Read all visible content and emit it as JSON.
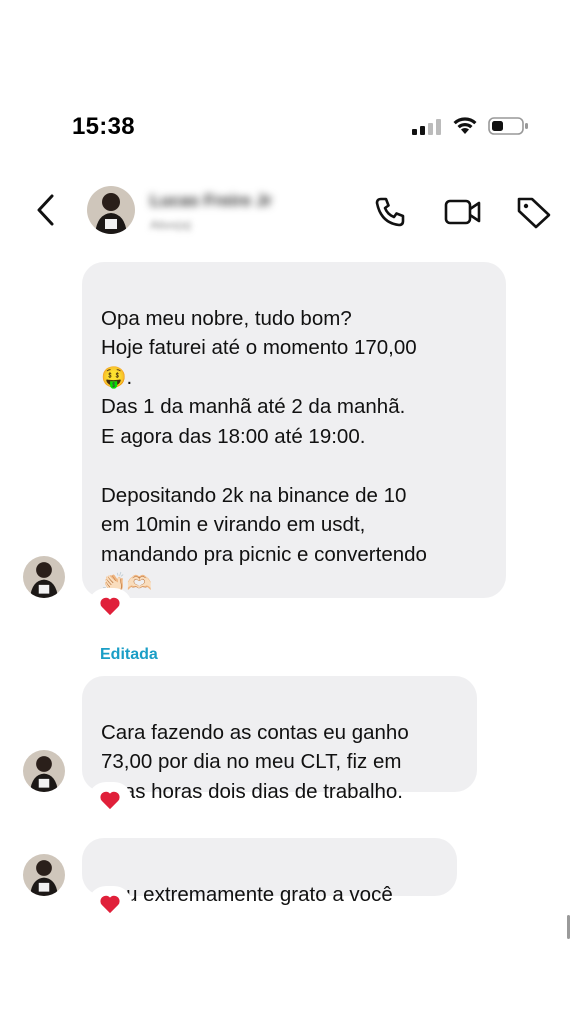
{
  "status_bar": {
    "time": "15:38"
  },
  "header": {
    "contact_name": "Lucas Freire Jr",
    "contact_status": "Ativo(a)"
  },
  "messages": [
    {
      "text": "Opa meu nobre, tudo bom?\nHoje faturei até o momento 170,00\n🤑.\nDas 1 da manhã até 2 da manhã.\nE agora das 18:00 até 19:00.\n\nDepositando 2k na binance de 10\nem 10min e virando em usdt,\nmandando pra picnic e convertendo\n👏🏻🫶🏻",
      "reaction": "❤"
    },
    {
      "edited_label": "Editada",
      "text": "Cara fazendo as contas eu ganho\n73,00 por dia no meu CLT,  fiz em\nduas horas dois dias de trabalho.",
      "reaction": "❤"
    },
    {
      "text": "Sou extremamente grato a você",
      "reaction": "❤"
    }
  ],
  "colors": {
    "bubble": "#efeff1",
    "edited": "#1a9ec6",
    "heart": "#e0203a"
  },
  "icons": [
    "back-arrow-icon",
    "phone-icon",
    "video-camera-icon",
    "tag-icon",
    "wifi-icon",
    "battery-icon",
    "signal-icon"
  ]
}
